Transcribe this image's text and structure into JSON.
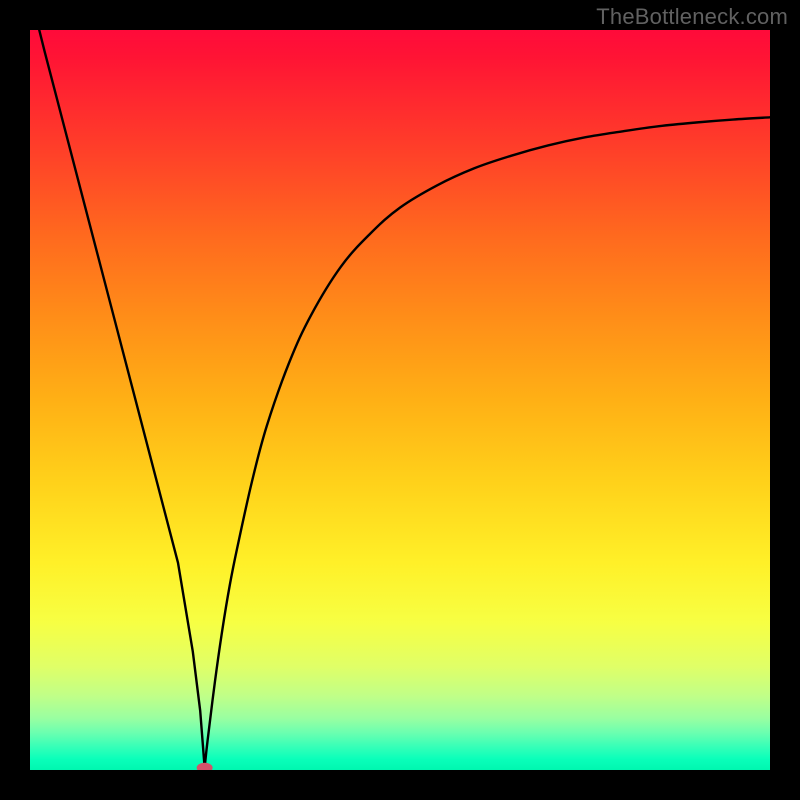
{
  "watermark": "TheBottleneck.com",
  "chart_data": {
    "type": "line",
    "title": "",
    "xlabel": "",
    "ylabel": "",
    "xlim": [
      0,
      100
    ],
    "ylim": [
      0,
      100
    ],
    "grid": false,
    "background_gradient": {
      "orientation": "vertical",
      "stops": [
        {
          "pos": 0.0,
          "color": "#ff0a3a"
        },
        {
          "pos": 0.28,
          "color": "#ff6a1e"
        },
        {
          "pos": 0.5,
          "color": "#ffb015"
        },
        {
          "pos": 0.72,
          "color": "#fff028"
        },
        {
          "pos": 0.86,
          "color": "#e0ff67"
        },
        {
          "pos": 0.95,
          "color": "#6affb0"
        },
        {
          "pos": 1.0,
          "color": "#00f7b0"
        }
      ]
    },
    "series": [
      {
        "name": "bottleneck-curve",
        "x": [
          0,
          2,
          5,
          8,
          11,
          14,
          17,
          20,
          22,
          23,
          23.6,
          24,
          25,
          26,
          27,
          28,
          30,
          32,
          35,
          38,
          42,
          46,
          50,
          55,
          60,
          65,
          70,
          75,
          80,
          85,
          90,
          95,
          100
        ],
        "y": [
          105,
          97,
          85.5,
          74,
          62.5,
          51,
          39.5,
          28,
          16,
          8,
          0.3,
          4,
          12,
          19,
          25,
          30,
          39,
          46.5,
          55,
          61.5,
          68,
          72.5,
          76,
          79,
          81.3,
          83,
          84.4,
          85.5,
          86.3,
          87,
          87.5,
          87.9,
          88.2
        ]
      }
    ],
    "markers": [
      {
        "name": "minimum-point",
        "x": 23.6,
        "y": 0.3,
        "color": "#d2536a",
        "shape": "pill"
      }
    ],
    "notch_min_x": 23.6
  },
  "colors": {
    "page_bg": "#000000",
    "watermark": "#616161",
    "curve": "#000000",
    "marker": "#d2536a"
  }
}
